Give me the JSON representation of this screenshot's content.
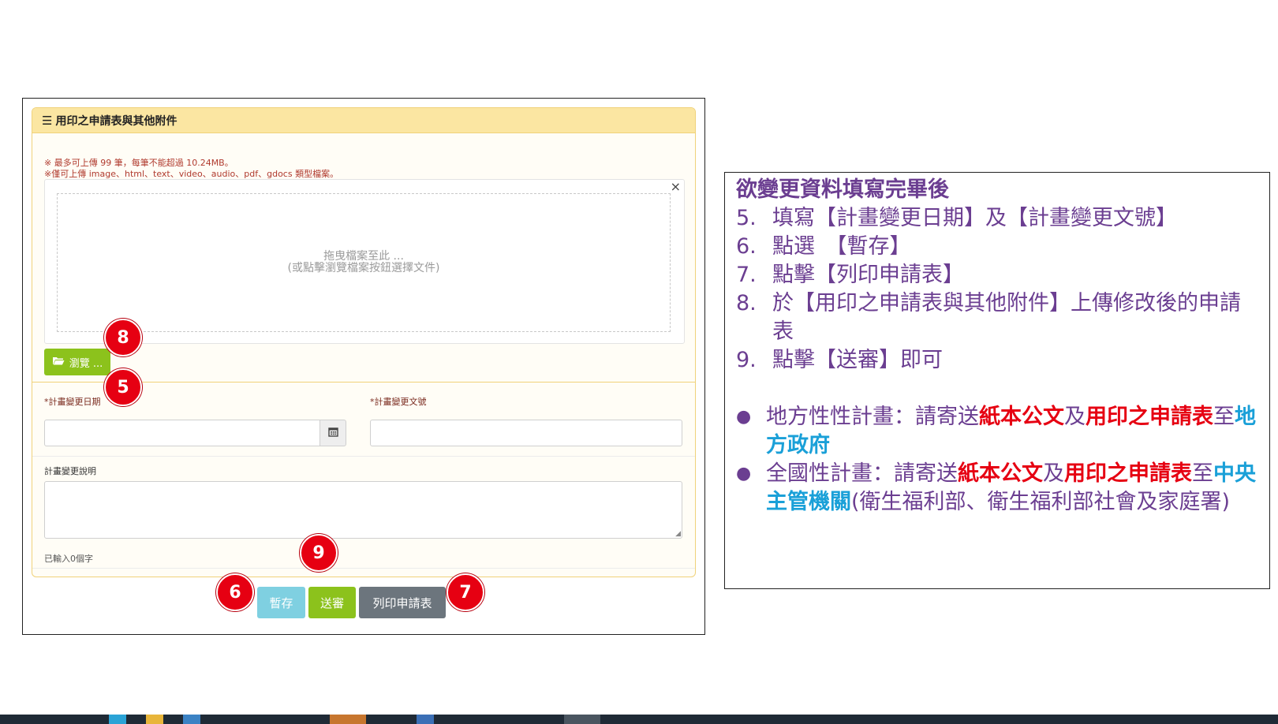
{
  "panel": {
    "title": "用印之申請表與其他附件",
    "note_max": "※ 最多可上傳 99 筆，每筆不能超過 10.24MB。",
    "note_types": "※僅可上傳 image、html、text、video、audio、pdf、gdocs 類型檔案。",
    "drop_line1": "拖曳檔案至此 ...",
    "drop_line2": "(或點擊瀏覽檔案按鈕選擇文件)",
    "close_symbol": "×",
    "browse_label": "瀏覽 ..."
  },
  "form": {
    "date_label": "*計畫變更日期",
    "docno_label": "*計畫變更文號",
    "desc_label": "計畫變更說明",
    "char_count": "已輸入0個字"
  },
  "actions": {
    "save_label": "暫存",
    "submit_label": "送審",
    "print_label": "列印申請表"
  },
  "markers": {
    "m5": "5",
    "m6": "6",
    "m7": "7",
    "m8": "8",
    "m9": "9"
  },
  "instructions": {
    "title": "欲變更資料填寫完畢後",
    "steps": [
      {
        "num": "5.",
        "text": "填寫【計畫變更日期】及【計畫變更文號】"
      },
      {
        "num": "6.",
        "text": "點選　【暫存】"
      },
      {
        "num": "7.",
        "text": "點擊【列印申請表】"
      },
      {
        "num": "8.",
        "text": "於【用印之申請表與其他附件】上傳修改後的申請表"
      },
      {
        "num": "9.",
        "text": "點擊【送審】即可"
      }
    ],
    "bullet1": {
      "a": "地方性性計畫：請寄送",
      "b": "紙本公文",
      "c": "及",
      "d": "用印之申請表",
      "e": "至",
      "f": "地方政府"
    },
    "bullet2": {
      "a": "全國性計畫：請寄送",
      "b": "紙本公文",
      "c": "及",
      "d": "用印之申請表",
      "e": "至",
      "f": "中央主管機關",
      "g": "(衛生福利部、衛生福利部社會及家庭署)"
    }
  },
  "colors": {
    "marker": "#e60012",
    "instruction_text": "#6b3e91",
    "highlight_red": "#e60012",
    "highlight_blue": "#1aa0d8",
    "browse": "#8cc21c",
    "save": "#7fd0e1",
    "print": "#6c757d"
  },
  "icons": {
    "menu": "menu-icon",
    "folder": "folder-open-icon",
    "calendar": "calendar-icon",
    "close": "close-icon",
    "bullet": "bullet-dot-icon"
  }
}
